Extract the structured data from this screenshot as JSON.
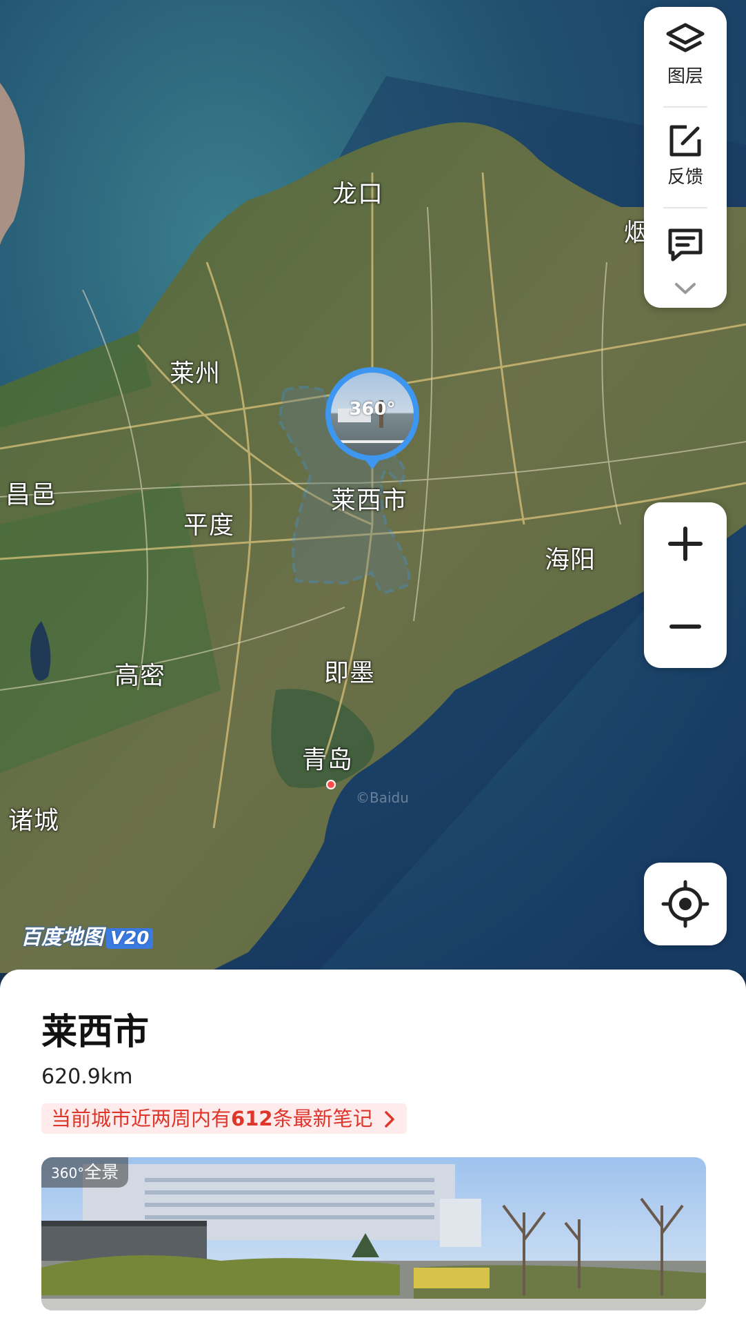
{
  "map": {
    "cities": [
      {
        "id": "longkou",
        "label": "龙口"
      },
      {
        "id": "yan",
        "label": "烟"
      },
      {
        "id": "laizhou",
        "label": "莱州"
      },
      {
        "id": "changyi",
        "label": "昌邑"
      },
      {
        "id": "pingdu",
        "label": "平度"
      },
      {
        "id": "laixi",
        "label": "莱西市"
      },
      {
        "id": "haiyang",
        "label": "海阳"
      },
      {
        "id": "gaomi",
        "label": "高密"
      },
      {
        "id": "jimo",
        "label": "即墨"
      },
      {
        "id": "qingdao",
        "label": "青岛"
      },
      {
        "id": "zhucheng",
        "label": "诸城"
      }
    ],
    "panorama_badge": "360°",
    "logo": {
      "text": "百度地图",
      "version": "V20"
    },
    "watermark": "©Baidu",
    "colors": {
      "boundary": "#3d97f0",
      "accent": "#e0352b"
    }
  },
  "toolbar": {
    "layers_label": "图层",
    "feedback_label": "反馈",
    "icons": [
      "layers-icon",
      "edit-feedback-icon",
      "message-icon",
      "chevron-down-icon"
    ]
  },
  "zoom": {
    "in_icon": "plus-icon",
    "out_icon": "minus-icon"
  },
  "locate": {
    "icon": "locate-icon"
  },
  "panel": {
    "title": "莱西市",
    "distance": "620.9km",
    "notes_prefix": "当前城市近两周内有",
    "notes_count": "612",
    "notes_suffix": "条最新笔记",
    "photo_badge_num": "360°",
    "photo_badge_text": "全景"
  }
}
